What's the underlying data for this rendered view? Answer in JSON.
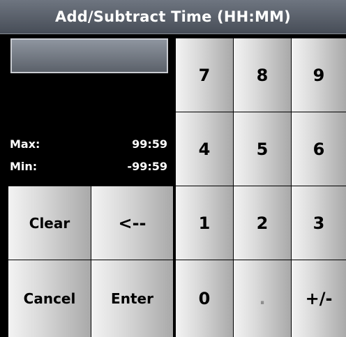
{
  "title": "Add/Subtract Time (HH:MM)",
  "display": {
    "value": ""
  },
  "limits": {
    "max_label": "Max:",
    "max_value": "99:59",
    "min_label": "Min:",
    "min_value": "-99:59"
  },
  "keypad": {
    "seven": "7",
    "eight": "8",
    "nine": "9",
    "four": "4",
    "five": "5",
    "six": "6",
    "one": "1",
    "two": "2",
    "three": "3",
    "zero": "0",
    "decimal": ".",
    "sign": "+/-"
  },
  "actions": {
    "clear": "Clear",
    "backspace": "<--",
    "cancel": "Cancel",
    "enter": "Enter"
  }
}
